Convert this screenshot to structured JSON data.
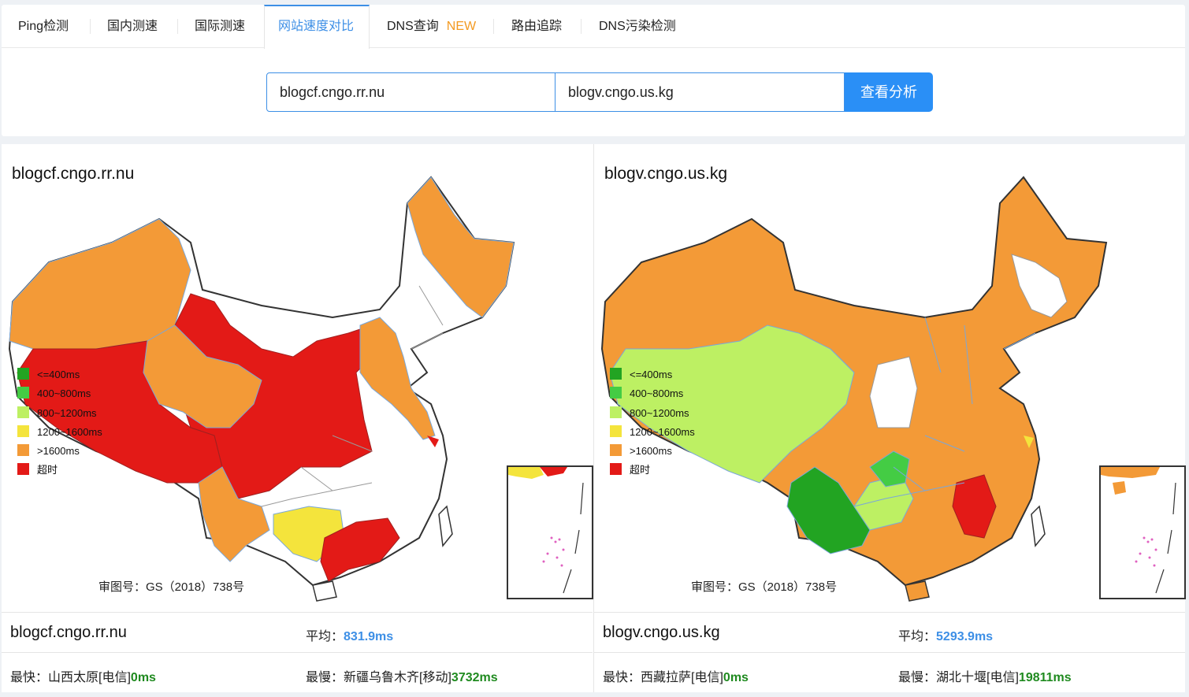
{
  "tabs": [
    {
      "label": "Ping检测"
    },
    {
      "label": "国内测速"
    },
    {
      "label": "国际测速"
    },
    {
      "label": "网站速度对比"
    },
    {
      "label": "DNS查询",
      "badge": "NEW"
    },
    {
      "label": "路由追踪"
    },
    {
      "label": "DNS污染检测"
    }
  ],
  "active_tab": "网站速度对比",
  "search": {
    "domain_a": "blogcf.cngo.rr.nu",
    "domain_b": "blogv.cngo.us.kg",
    "button": "查看分析"
  },
  "legend": [
    {
      "label": "<=400ms",
      "color": "#22a422"
    },
    {
      "label": "400~800ms",
      "color": "#44cc44"
    },
    {
      "label": "800~1200ms",
      "color": "#bdf063"
    },
    {
      "label": "1200~1600ms",
      "color": "#f4e43c"
    },
    {
      "label": ">1600ms",
      "color": "#f39a37"
    },
    {
      "label": "超时",
      "color": "#e31a17"
    }
  ],
  "approval_number": "审图号：GS（2018）738号",
  "results": [
    {
      "domain": "blogcf.cngo.rr.nu",
      "avg_label": "平均：",
      "avg_value": "831.9ms",
      "fastest_label": "最快：",
      "fastest_location": "山西太原[电信]",
      "fastest_value": "0ms",
      "slowest_label": "最慢：",
      "slowest_location": "新疆乌鲁木齐[移动]",
      "slowest_value": "3732ms"
    },
    {
      "domain": "blogv.cngo.us.kg",
      "avg_label": "平均：",
      "avg_value": "5293.9ms",
      "fastest_label": "最快：",
      "fastest_location": "西藏拉萨[电信]",
      "fastest_value": "0ms",
      "slowest_label": "最慢：",
      "slowest_location": "湖北十堰[电信]",
      "slowest_value": "19811ms"
    }
  ],
  "colors": {
    "accent": "#3d8fe6",
    "button": "#2a8ff6",
    "new_badge": "#f39a21",
    "fast_value": "#1f8a1f"
  }
}
